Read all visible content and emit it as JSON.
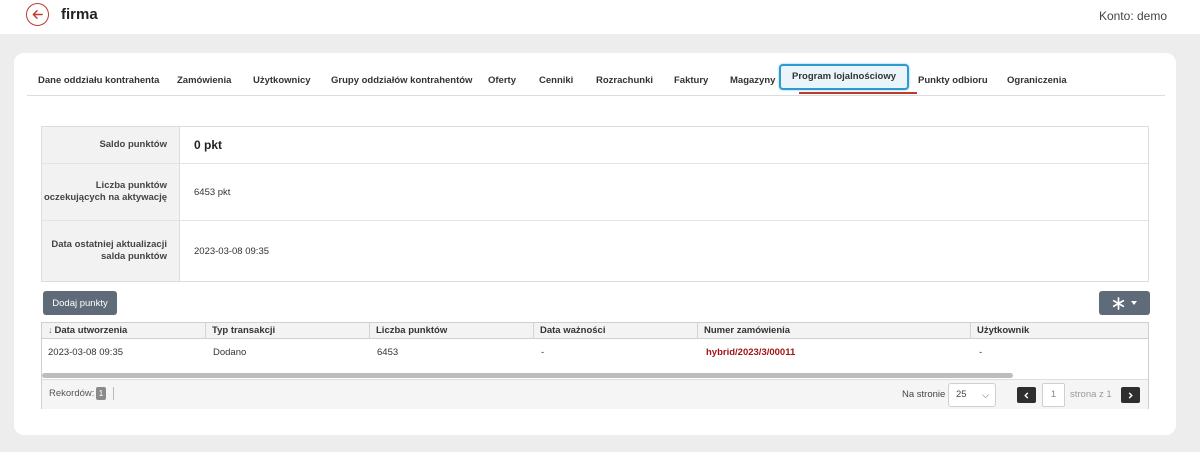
{
  "header": {
    "title": "firma",
    "account": "Konto: demo"
  },
  "tabs": [
    "Dane oddziału kontrahenta",
    "Zamówienia",
    "Użytkownicy",
    "Grupy oddziałów kontrahentów",
    "Oferty",
    "Cenniki",
    "Rozrachunki",
    "Faktury",
    "Magazyny",
    "Program lojalnościowy",
    "Punkty odbioru",
    "Ograniczenia"
  ],
  "active_tab": "Program lojalnościowy",
  "info": [
    {
      "label": "Saldo punktów",
      "value": "0 pkt"
    },
    {
      "label": "Liczba punktów oczekujących na aktywację",
      "value": "6453 pkt"
    },
    {
      "label": "Data ostatniej aktualizacji salda punktów",
      "value": "2023-03-08 09:35"
    }
  ],
  "actions": {
    "add_points": "Dodaj punkty",
    "tools_icon": "asterisk-icon"
  },
  "grid": {
    "columns": [
      "Data utworzenia",
      "Typ transakcji",
      "Liczba punktów",
      "Data ważności",
      "Numer zamówienia",
      "Użytkownik"
    ],
    "rows": [
      [
        "2023-03-08 09:35",
        "Dodano",
        "6453",
        "-",
        "hybrid/2023/3/00011",
        "-"
      ]
    ]
  },
  "footer": {
    "records_label": "Rekordów:",
    "records_count": "1",
    "per_page_label": "Na stronie",
    "per_page_value": "25",
    "current_page": "1",
    "page_of": "strona z 1"
  },
  "colors": {
    "accent": "#c0392b",
    "active_tab_border": "#2d9ad1",
    "button": "#5f6b78",
    "link": "#a31515"
  }
}
